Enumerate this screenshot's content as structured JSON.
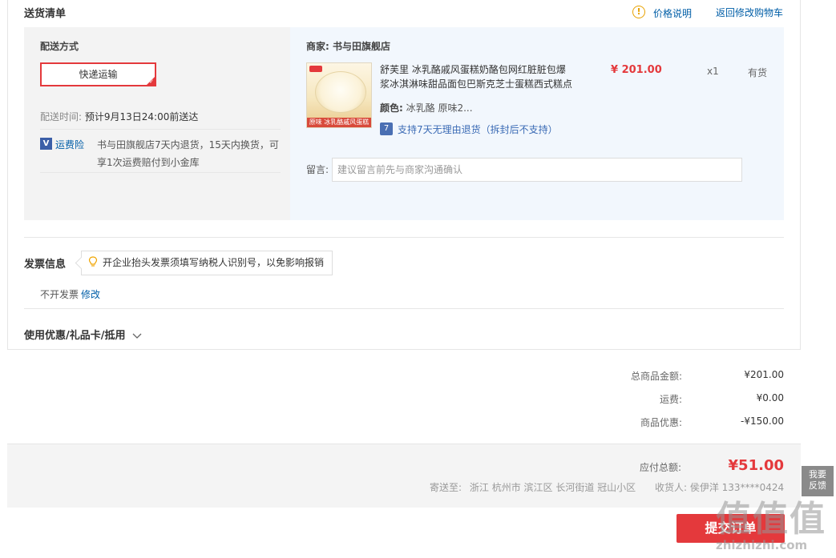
{
  "header": {
    "title": "送货清单",
    "price_note_icon": "warning-circle-icon",
    "price_note": "价格说明",
    "back_to_cart": "返回修改购物车"
  },
  "shipping": {
    "method_label": "配送方式",
    "method_selected": "快递运输",
    "time_label": "配送时间:",
    "time_value": "预计9月13日24:00前送达",
    "insurance_icon": "shipping-insurance-icon",
    "insurance_label": "运费险",
    "insurance_desc_line1": "书与田旗舰店7天内退货，15天内换货，可",
    "insurance_desc_line2": "享1次运费赔付到小金库"
  },
  "goods": {
    "shop_label": "商家: 书与田旗舰店",
    "product_name_line1": "舒芙里 冰乳酪戚风蛋糕奶酪包网红脏脏包爆",
    "product_name_line2": "浆冰淇淋味甜品面包巴斯克芝士蛋糕西式糕点",
    "image_caption": "原味 冰乳酪戚风蛋糕",
    "price": "¥ 201.00",
    "qty": "x1",
    "stock": "有货",
    "color_label": "颜色:",
    "color_value": "冰乳酪 原味2...",
    "return_icon": "return-policy-icon",
    "return_text": "支持7天无理由退货（拆封后不支持）",
    "memo_label": "留言:",
    "memo_placeholder": "建议留言前先与商家沟通确认"
  },
  "invoice": {
    "title": "发票信息",
    "tip_icon": "lightbulb-icon",
    "tip": "开企业抬头发票须填写纳税人识别号，以免影响报销",
    "status": "不开发票",
    "edit": "修改"
  },
  "coupon": {
    "label": "使用优惠/礼品卡/抵用",
    "icon": "chevron-down-icon"
  },
  "summary": {
    "goods_total_label": "总商品金额:",
    "goods_total": "¥201.00",
    "freight_label": "运费:",
    "freight": "¥0.00",
    "discount_label": "商品优惠:",
    "discount": "-¥150.00"
  },
  "payment": {
    "total_label": "应付总额:",
    "total": "¥51.00",
    "ship_to_label": "寄送至:",
    "address": "浙江 杭州市 滨江区 长河街道 冠山小区",
    "receiver_label": "收货人:",
    "receiver": "侯伊洋 133****0424",
    "submit": "提交订单"
  },
  "feedback": {
    "line1": "我要",
    "line2": "反馈"
  },
  "watermark": {
    "text": "值值值",
    "url": "zhizhizhi.com"
  },
  "colors": {
    "accent_red": "#e4393c",
    "link_blue": "#005ea7"
  }
}
